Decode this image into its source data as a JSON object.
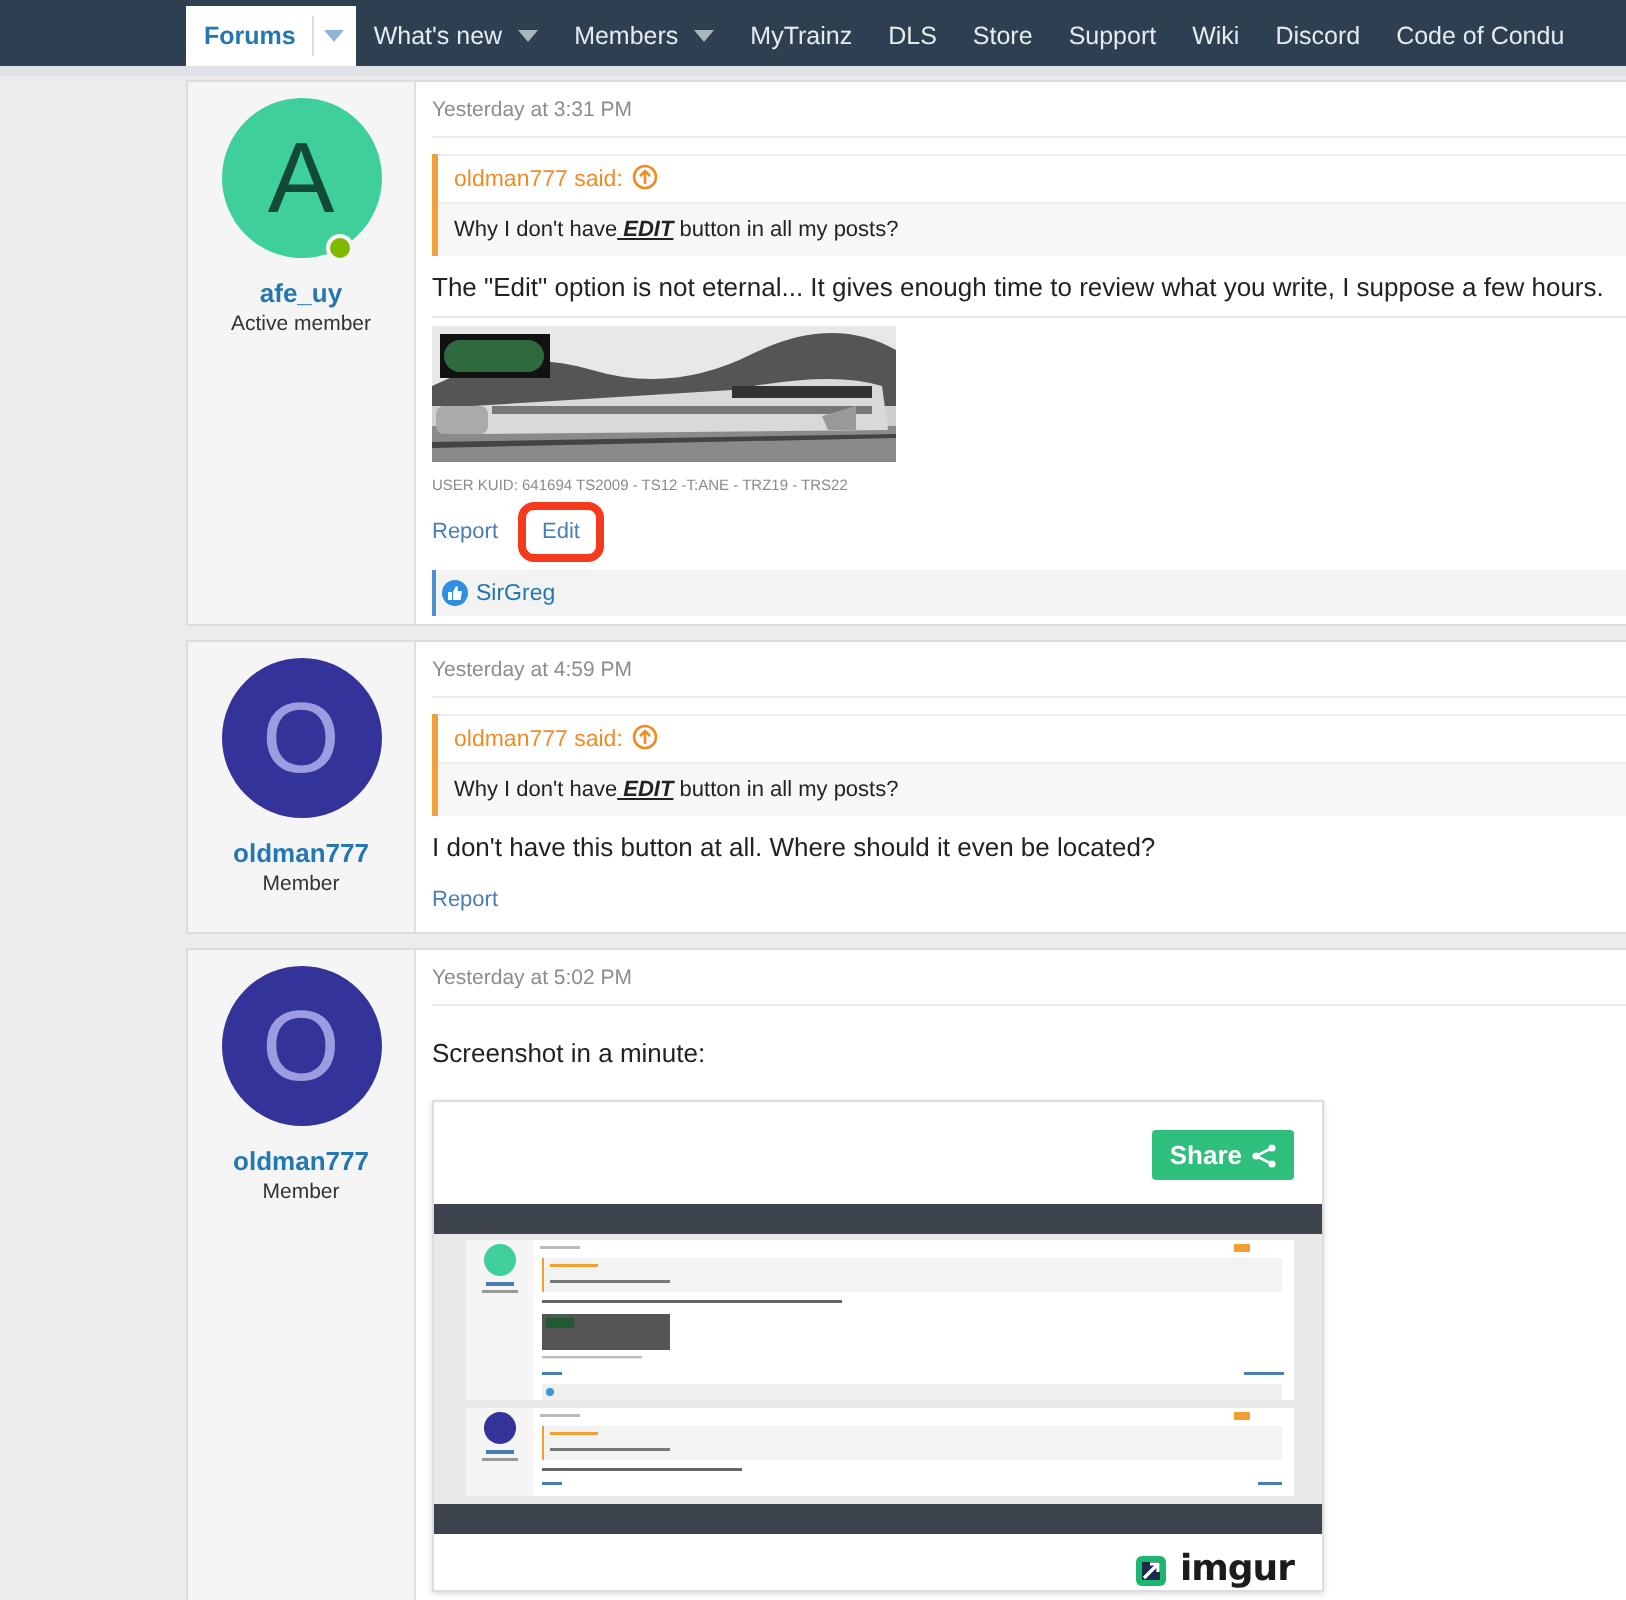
{
  "nav": {
    "items": [
      {
        "label": "Forums",
        "selected": true,
        "dropdown": true
      },
      {
        "label": "What's new",
        "selected": false,
        "dropdown": true
      },
      {
        "label": "Members",
        "selected": false,
        "dropdown": true
      },
      {
        "label": "MyTrainz",
        "selected": false,
        "dropdown": false
      },
      {
        "label": "DLS",
        "selected": false,
        "dropdown": false
      },
      {
        "label": "Store",
        "selected": false,
        "dropdown": false
      },
      {
        "label": "Support",
        "selected": false,
        "dropdown": false
      },
      {
        "label": "Wiki",
        "selected": false,
        "dropdown": false
      },
      {
        "label": "Discord",
        "selected": false,
        "dropdown": false
      },
      {
        "label": "Code of Condu",
        "selected": false,
        "dropdown": false
      }
    ]
  },
  "posts": [
    {
      "avatar": {
        "letter": "A",
        "color": "#3ecf9a",
        "online": true
      },
      "author": "afe_uy",
      "role": "Active member",
      "time": "Yesterday at 3:31 PM",
      "quote": {
        "author_line": "oldman777 said:",
        "before": "Why I don't have",
        "emphasis": "EDIT",
        "after": "button in all my posts?"
      },
      "body": "The \"Edit\" option is not eternal... It gives enough time to review what you write, I suppose a few hours.",
      "attachment": {
        "kind": "picture"
      },
      "signature": "USER KUID: 641694 TS2009 - TS12 -T:ANE - TRZ19 - TRS22",
      "actions": [
        {
          "label": "Report",
          "highlighted": false
        },
        {
          "label": "Edit",
          "highlighted": true
        }
      ],
      "reactions": {
        "users": "SirGreg"
      }
    },
    {
      "avatar": {
        "letter": "O",
        "color": "#33339a",
        "online": false
      },
      "author": "oldman777",
      "role": "Member",
      "time": "Yesterday at 4:59 PM",
      "quote": {
        "author_line": "oldman777 said:",
        "before": "Why I don't have",
        "emphasis": "EDIT",
        "after": "button in all my posts?"
      },
      "body": "I don't have this button at all. Where should it even be located?",
      "actions": [
        {
          "label": "Report",
          "highlighted": false
        }
      ]
    },
    {
      "avatar": {
        "letter": "O",
        "color": "#33339a",
        "online": false
      },
      "author": "oldman777",
      "role": "Member",
      "time": "Yesterday at 5:02 PM",
      "body": "Screenshot in a minute:",
      "embed": {
        "kind": "imgur",
        "share_label": "Share",
        "brand": "imgur"
      }
    }
  ]
}
